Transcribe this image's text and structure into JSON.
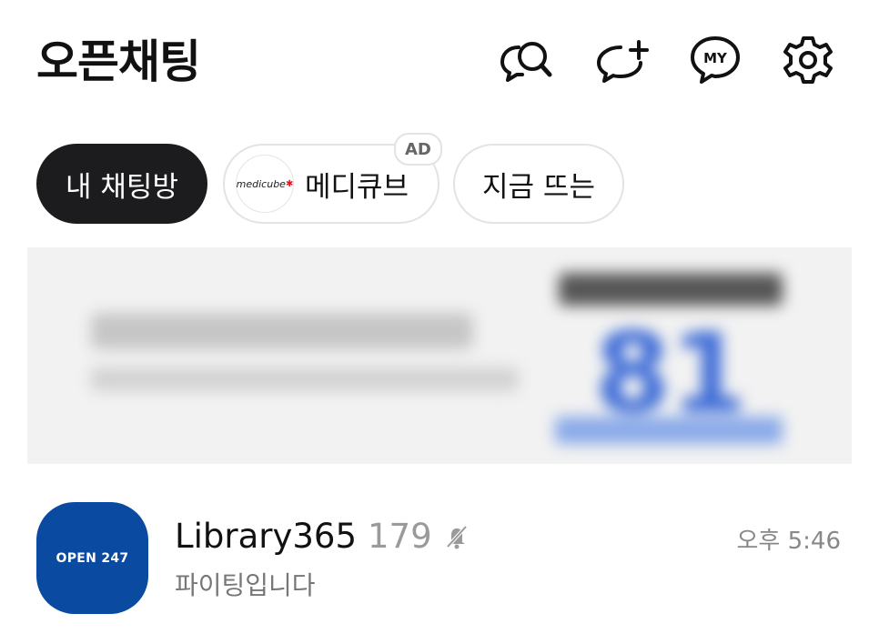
{
  "header": {
    "title": "오픈채팅",
    "icons": [
      "chat-search-icon",
      "chat-add-icon",
      "my-chat-icon",
      "gear-icon"
    ],
    "my_label": "MY"
  },
  "chips": {
    "my_chats": "내 채팅방",
    "ad_brand_logo": "medicube",
    "ad_label": "메디큐브",
    "ad_badge": "AD",
    "trending": "지금 뜨는"
  },
  "banner": {
    "big_number": "81"
  },
  "chat_rooms": [
    {
      "avatar_text": "OPEN 247",
      "name": "Library365",
      "member_count": "179",
      "muted": true,
      "last_message": "파이팅입니다",
      "time": "오후 5:46"
    }
  ],
  "colors": {
    "active_chip": "#1c1c1e",
    "avatar_bg": "#0a4aa0",
    "banner_accent": "#3b6ad6"
  }
}
